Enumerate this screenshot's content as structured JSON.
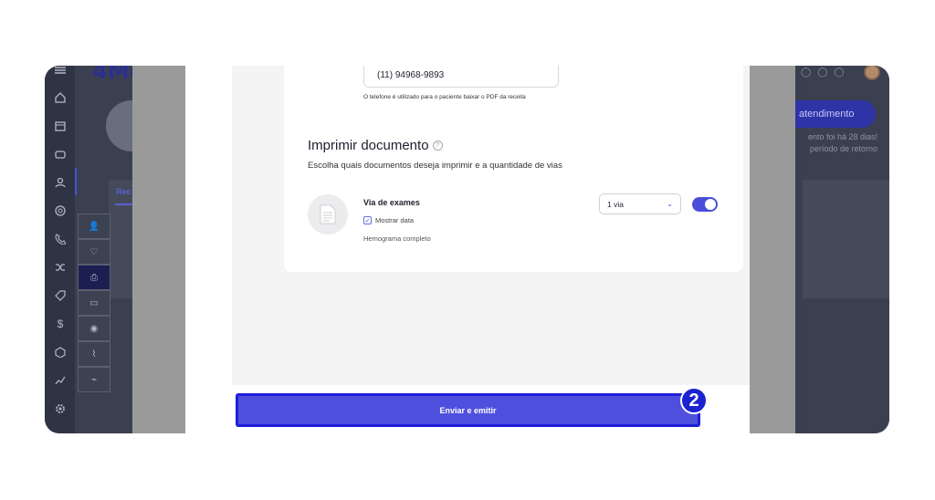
{
  "app": {
    "logo_text": "4Me"
  },
  "background": {
    "tab_label": "Rec",
    "cta_label": "atendimento",
    "notice": "ento foi há 28 dias! período de retorno"
  },
  "modal": {
    "phone": {
      "value": "(11) 94968-9893",
      "help": "O telefone é utilizado para o paciente baixar o PDF da receita"
    },
    "print_section": {
      "title": "Imprimir documento",
      "subtitle": "Escolha quais documentos deseja imprimir e a quantidade de vias"
    },
    "document": {
      "title": "Via de exames",
      "checkbox_label": "Mostrar data",
      "checkbox_checked": true,
      "description": "Hemograma completo",
      "copies_selected": "1 via",
      "enabled": true
    },
    "submit_label": "Enviar e emitir"
  },
  "step_badge": "2",
  "colors": {
    "accent": "#4a4ed8",
    "overlay": "#3a3f50"
  }
}
